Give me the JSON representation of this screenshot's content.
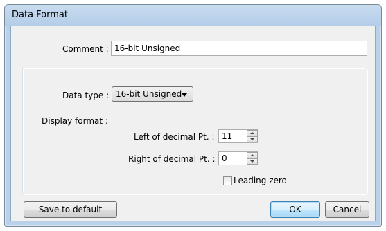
{
  "window": {
    "title": "Data Format"
  },
  "comment": {
    "label": "Comment :",
    "value": "16-bit Unsigned"
  },
  "data_type": {
    "label": "Data type :",
    "selected": "16-bit Unsigned"
  },
  "display_format": {
    "label": "Display format :",
    "left_label": "Left of decimal Pt. :",
    "left_value": "11",
    "right_label": "Right of decimal Pt. :",
    "right_value": "0",
    "leading_zero_label": "Leading zero",
    "leading_zero_checked": false
  },
  "buttons": {
    "save_default": "Save to default",
    "ok": "OK",
    "cancel": "Cancel"
  },
  "colors": {
    "window_frame": "#b9d1ea",
    "client_bg": "#f0f0f0",
    "default_button_border": "#3c7fb1"
  }
}
